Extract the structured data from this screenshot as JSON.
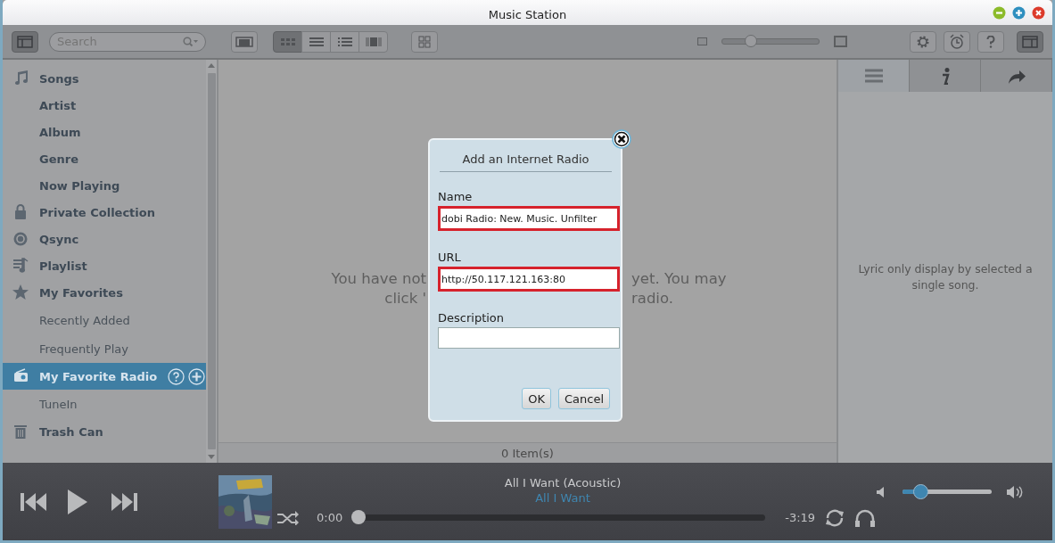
{
  "window": {
    "title": "Music Station"
  },
  "toolbar": {
    "search": {
      "placeholder": "Search"
    },
    "view_modes": [
      {
        "selected": true
      },
      {
        "selected": false
      },
      {
        "selected": false
      },
      {
        "selected": false
      }
    ],
    "zoom": {
      "level": 0.3
    }
  },
  "sidebar": {
    "items": [
      {
        "label": "Songs",
        "kind": "section",
        "selected": false
      },
      {
        "label": "Artist",
        "kind": "category",
        "selected": false
      },
      {
        "label": "Album",
        "kind": "category",
        "selected": false
      },
      {
        "label": "Genre",
        "kind": "category",
        "selected": false
      },
      {
        "label": "Now Playing",
        "kind": "category",
        "selected": false
      },
      {
        "label": "Private Collection",
        "kind": "section",
        "selected": false
      },
      {
        "label": "Qsync",
        "kind": "section",
        "selected": false
      },
      {
        "label": "Playlist",
        "kind": "section",
        "selected": false
      },
      {
        "label": "My Favorites",
        "kind": "section",
        "selected": false
      },
      {
        "label": "Recently Added",
        "kind": "link",
        "selected": false
      },
      {
        "label": "Frequently Play",
        "kind": "link",
        "selected": false
      },
      {
        "label": "My Favorite Radio",
        "kind": "section",
        "selected": true
      },
      {
        "label": "TuneIn",
        "kind": "link",
        "selected": false
      },
      {
        "label": "Trash Can",
        "kind": "section",
        "selected": false
      }
    ]
  },
  "content": {
    "message_lines": [
      {
        "left": "You have not",
        "right": "yet. You may"
      },
      {
        "left": "click '",
        "right": "radio."
      }
    ],
    "item_count": "0 Item(s)"
  },
  "right_panel": {
    "tabs": [
      {
        "selected": true
      },
      {
        "selected": false
      },
      {
        "selected": false
      }
    ],
    "note": "Lyric only display by selected a single song."
  },
  "dialog": {
    "title": "Add an Internet Radio",
    "fields": [
      {
        "label": "Name",
        "value": "dobi Radio: New. Music. Unfilter",
        "highlighted": true
      },
      {
        "label": "URL",
        "value": "http://50.117.121.163:80",
        "highlighted": true
      },
      {
        "label": "Description",
        "highlighted": false
      }
    ],
    "buttons": [
      "OK",
      "Cancel"
    ]
  },
  "player": {
    "title": "All I Want (Acoustic)",
    "artist": "All I Want",
    "elapsed": "0:00",
    "remaining": "-3:19",
    "progress": {
      "level": 0
    },
    "volume": {
      "level": 0.2
    }
  }
}
